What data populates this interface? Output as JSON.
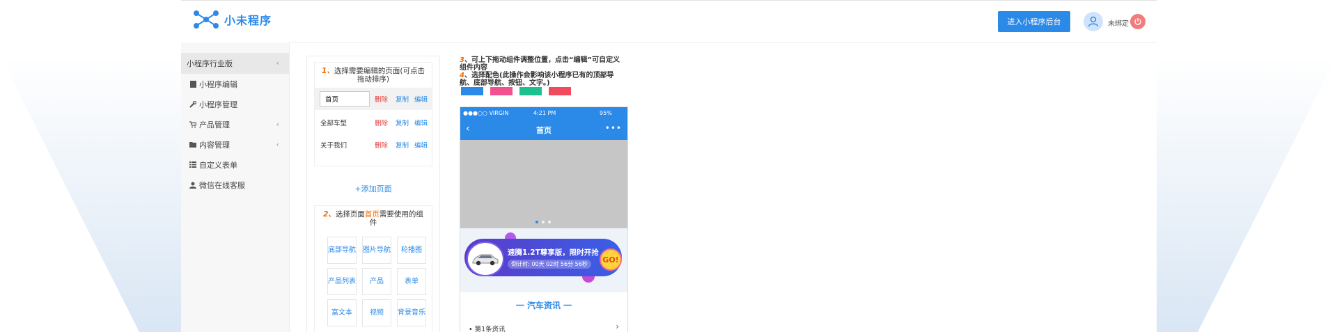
{
  "header": {
    "logo_text": "小未程序",
    "enter_button": "进入小程序后台",
    "user_name": "未绑定"
  },
  "sidebar": {
    "header": "小程序行业版",
    "items": [
      {
        "label": "小程序编辑",
        "icon": "book-icon"
      },
      {
        "label": "小程序管理",
        "icon": "wrench-icon"
      },
      {
        "label": "产品管理",
        "icon": "cart-icon"
      },
      {
        "label": "内容管理",
        "icon": "folder-icon"
      },
      {
        "label": "自定义表单",
        "icon": "list-icon"
      },
      {
        "label": "微信在线客服",
        "icon": "user-icon"
      }
    ]
  },
  "step1": {
    "num": "1、",
    "title": "选择需要编辑的页面(可点击拖动排序)",
    "pages": [
      {
        "label": "首页",
        "delete": "删除",
        "copy": "复制",
        "edit": "编辑"
      },
      {
        "label": "全部车型",
        "delete": "删除",
        "copy": "复制",
        "edit": "编辑"
      },
      {
        "label": "关于我们",
        "delete": "删除",
        "copy": "复制",
        "edit": "编辑"
      }
    ],
    "add_page": "+添加页面"
  },
  "step2": {
    "num": "2、",
    "title_pre": "选择页面",
    "title_hl": "首页",
    "title_post": "需要使用的组件",
    "components": [
      "底部导航",
      "图片导航",
      "轮播图",
      "产品列表",
      "产品",
      "表单",
      "富文本",
      "视频",
      "背景音乐"
    ]
  },
  "instructions": {
    "num3": "3",
    "text3": "、可上下拖动组件调整位置，点击“编辑”可自定义组件内容",
    "num4": "4",
    "text4": "、选择配色(此操作会影响该小程序已有的顶部导航、底部导航、按钮、文字。)"
  },
  "swatches": [
    "#2b8ae8",
    "#f2508f",
    "#1ec08f",
    "#f04a5c"
  ],
  "phone": {
    "carrier": "●●●○○ VIRGIN",
    "time": "4:21 PM",
    "battery": "95%",
    "nav_title": "首页",
    "banner_text": "速腾1.2T尊享版，限时开抢",
    "banner_countdown": "倒计时: 00天 02时 56分 56秒",
    "go": "GO!",
    "news_title": "一 汽车资讯 一",
    "news_item": "第1条资讯"
  }
}
